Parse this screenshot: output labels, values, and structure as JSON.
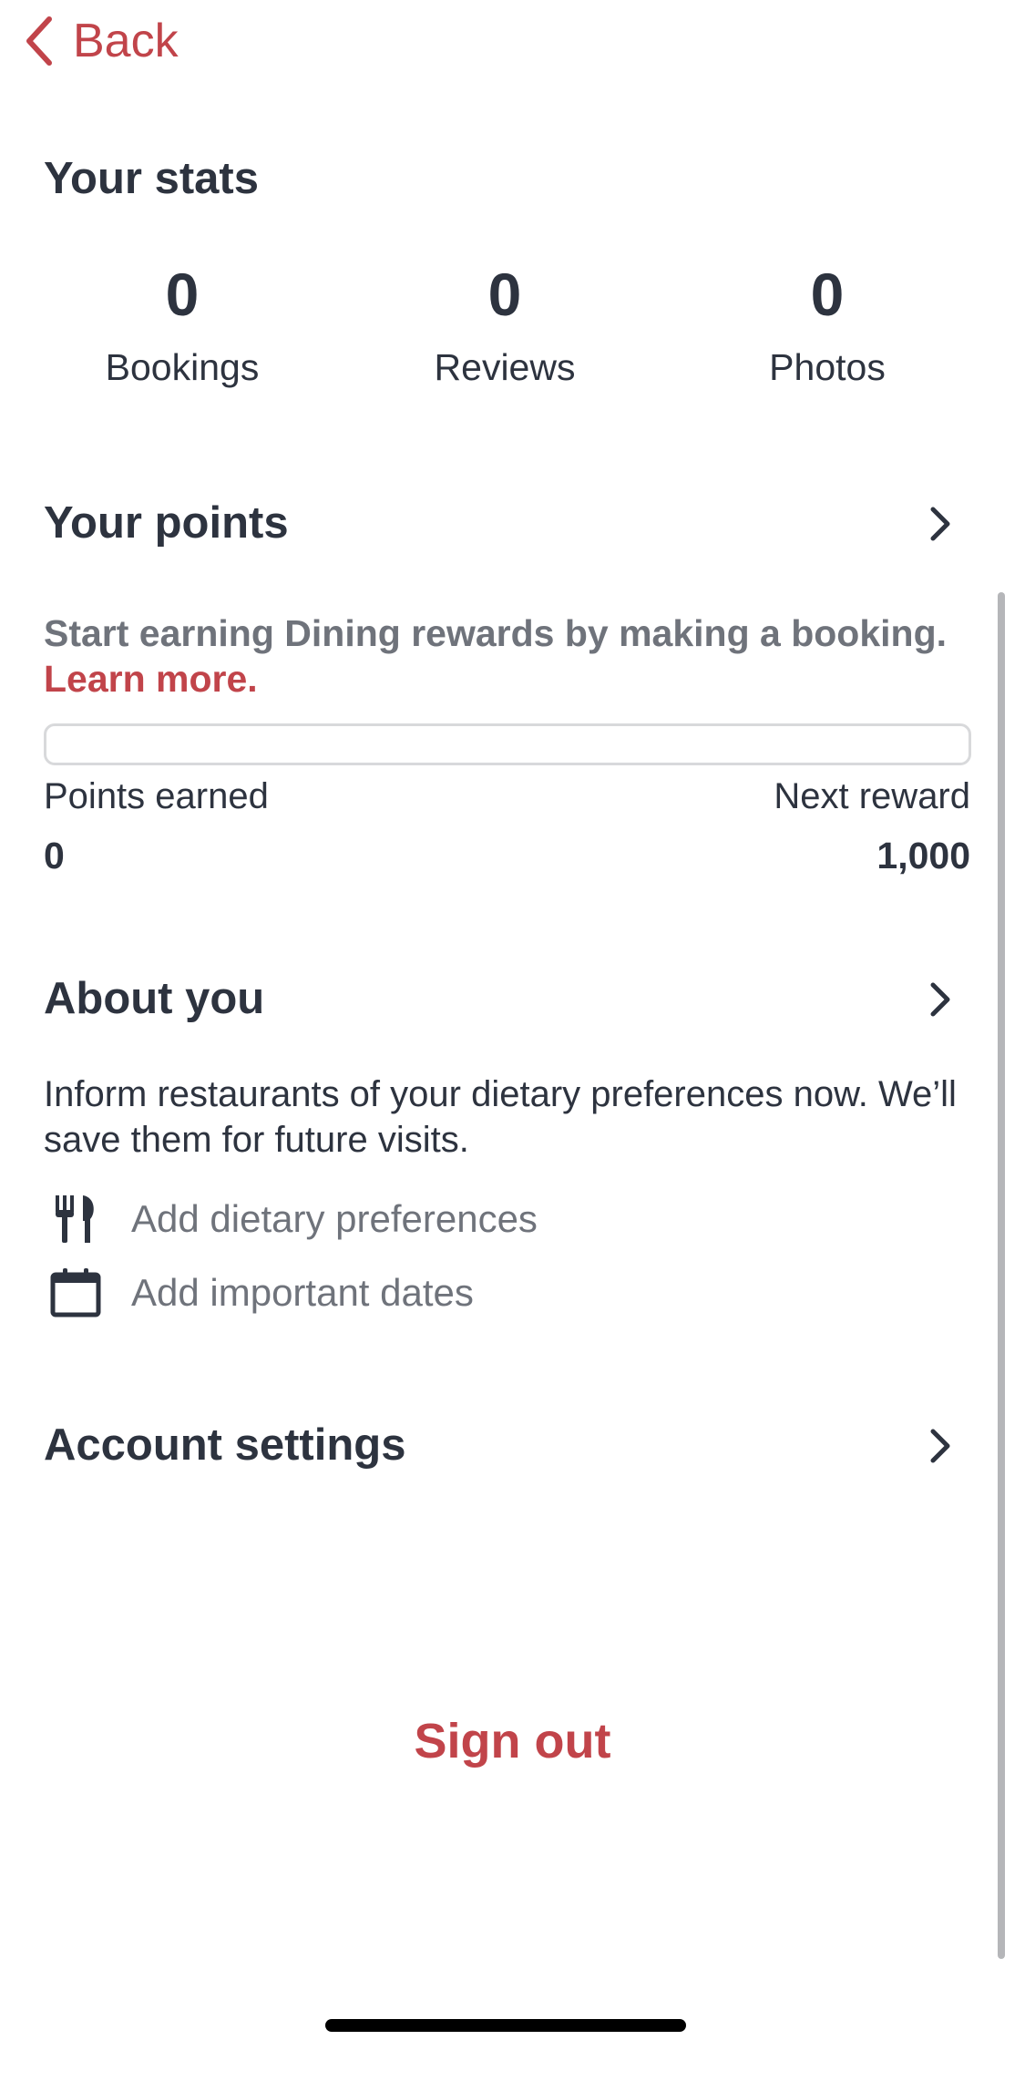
{
  "nav": {
    "back_label": "Back"
  },
  "stats": {
    "title": "Your stats",
    "items": [
      {
        "value": "0",
        "label": "Bookings"
      },
      {
        "value": "0",
        "label": "Reviews"
      },
      {
        "value": "0",
        "label": "Photos"
      }
    ]
  },
  "points": {
    "title": "Your points",
    "message": "Start earning Dining rewards by making a booking. ",
    "learn_more": "Learn more.",
    "progress_fraction": 0,
    "earned_label": "Points earned",
    "earned_value": "0",
    "next_label": "Next reward",
    "next_value": "1,000"
  },
  "about": {
    "title": "About you",
    "description": "Inform restaurants of your dietary preferences now. We’ll save them for future visits.",
    "actions": [
      {
        "icon": "fork-knife-icon",
        "label": "Add dietary preferences"
      },
      {
        "icon": "calendar-icon",
        "label": "Add important dates"
      }
    ]
  },
  "account": {
    "title": "Account settings"
  },
  "sign_out": {
    "label": "Sign out"
  },
  "colors": {
    "accent": "#c1444a",
    "text": "#2d333f",
    "muted": "#6f737b"
  }
}
